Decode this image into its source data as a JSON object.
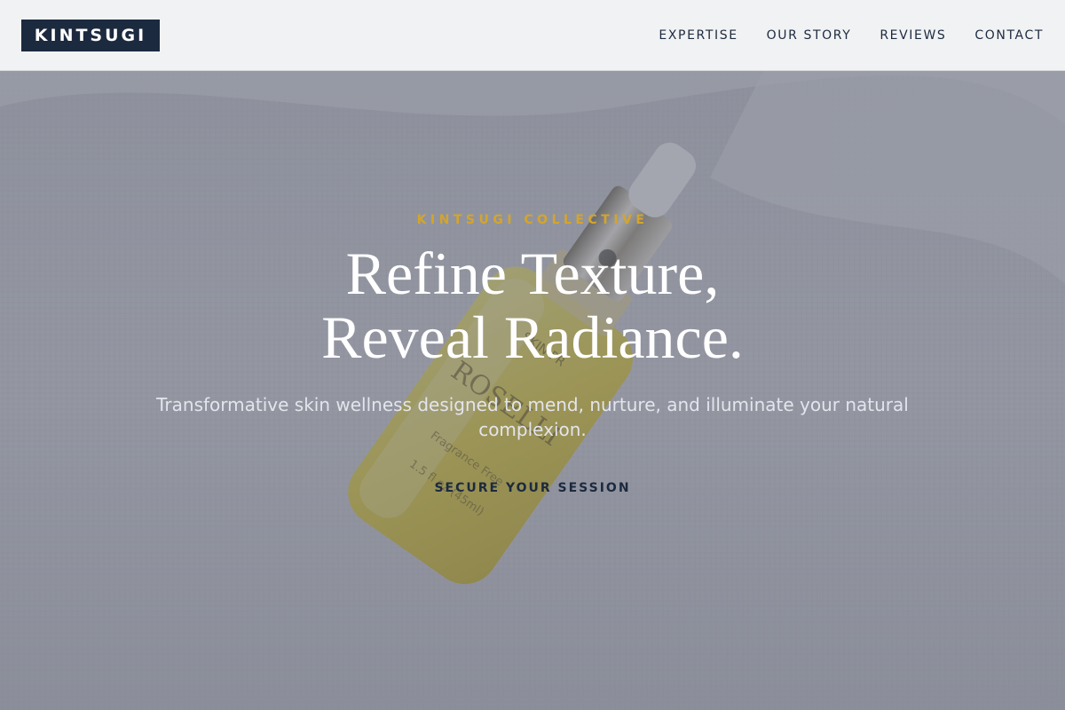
{
  "header": {
    "logo_text": "KINTSUGI",
    "nav": [
      {
        "label": "EXPERTISE"
      },
      {
        "label": "OUR STORY"
      },
      {
        "label": "REVIEWS"
      },
      {
        "label": "CONTACT"
      }
    ]
  },
  "hero": {
    "eyebrow": "KINTSUGI COLLECTIVE",
    "title_line1": "Refine Texture,",
    "title_line2": "Reveal Radiance.",
    "subtitle": "Transformative skin wellness designed to mend, nurture, and illuminate your natural complexion.",
    "cta_label": "SECURE YOUR SESSION",
    "background_image": "skincare-serum-bottle-photo"
  },
  "colors": {
    "brand_navy": "#1c2a3f",
    "accent_gold": "#d4a52c",
    "header_bg": "#f1f2f3"
  }
}
